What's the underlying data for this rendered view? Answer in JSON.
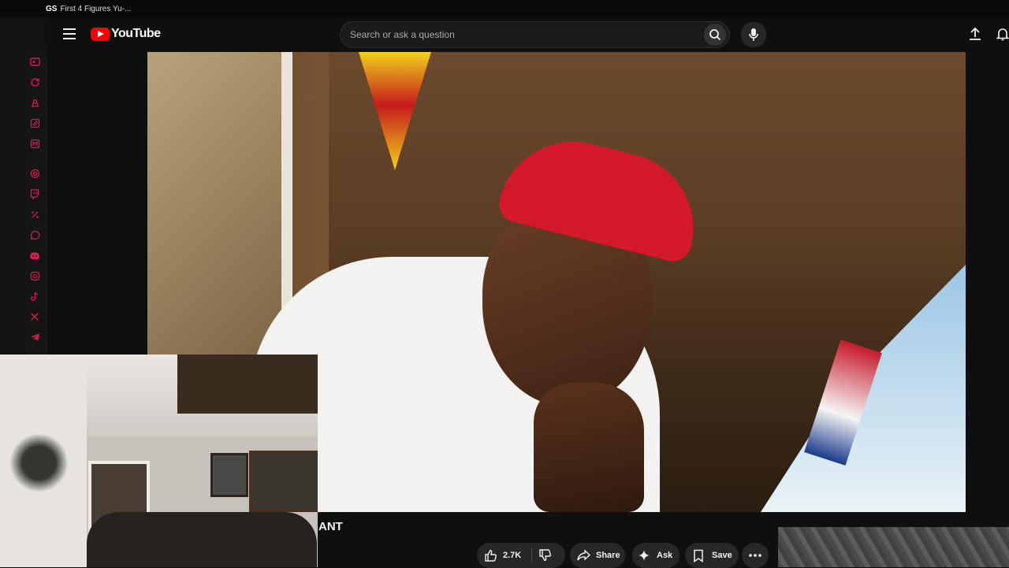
{
  "browser": {
    "tab_favicon": "GS",
    "tab_title": "First 4 Figures Yu-..."
  },
  "masthead": {
    "logo_text": "YouTube",
    "search_placeholder": "Search or ask a question",
    "icons": [
      "menu-icon",
      "youtube-logo-icon",
      "search-icon",
      "mic-icon",
      "upload-icon",
      "bell-icon"
    ]
  },
  "extensions": [
    "media-icon",
    "refresh-icon",
    "tag-icon",
    "note-icon",
    "mail-icon",
    "ai-icon",
    "twitch-icon",
    "percent-icon",
    "whatsapp-icon",
    "discord-icon",
    "instagram-icon",
    "tiktok-icon",
    "x-icon",
    "telegram-icon"
  ],
  "video": {
    "title_fragment": "ANT"
  },
  "actions": {
    "like_count": "2.7K",
    "share_label": "Share",
    "ask_label": "Ask",
    "save_label": "Save"
  },
  "colors": {
    "accent": "#ff0000",
    "extension_icon": "#d81b4a",
    "background": "#0f0f0f",
    "pill": "#272727"
  }
}
